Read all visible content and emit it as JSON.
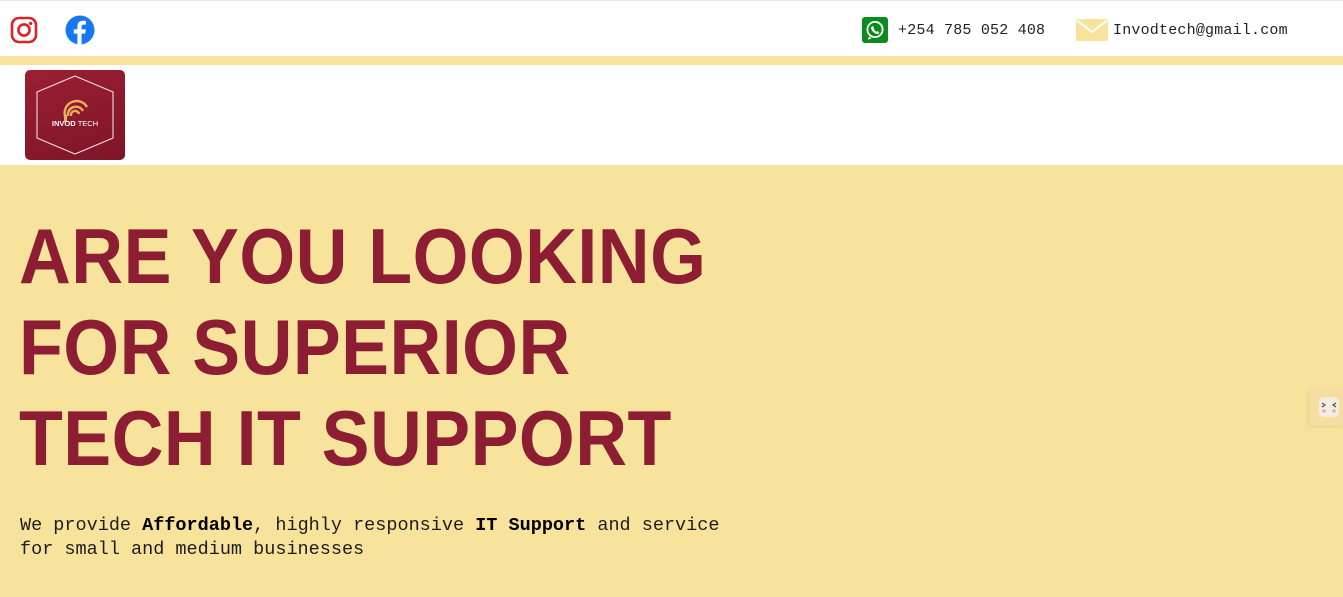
{
  "topbar": {
    "social": [
      {
        "icon": "instagram-icon",
        "color": "#d8232a"
      },
      {
        "icon": "facebook-icon",
        "color": "#1877f2"
      }
    ],
    "phone": {
      "icon": "whatsapp-icon",
      "text": "+254 785 052 408",
      "icon_color": "#0b8a1d"
    },
    "email": {
      "icon": "envelope-icon",
      "text": "Invodtech@gmail.com",
      "icon_color": "#f8e39d"
    }
  },
  "logo": {
    "text": "INVOD TECH",
    "background": "#8c1d32",
    "accent": "#e9b15a"
  },
  "hero": {
    "headline": [
      "ARE YOU LOOKING",
      "FOR SUPERIOR",
      "TECH IT SUPPORT"
    ],
    "subtext": {
      "part1": "We provide ",
      "bold1": "Affordable",
      "part2": ", highly responsive ",
      "bold2": "IT Support",
      "part3": " and service for small and medium businesses"
    },
    "background": "#f8e39d",
    "headline_color": "#8c1d32"
  },
  "side_widget": {
    "icon": "chat-face-icon"
  }
}
